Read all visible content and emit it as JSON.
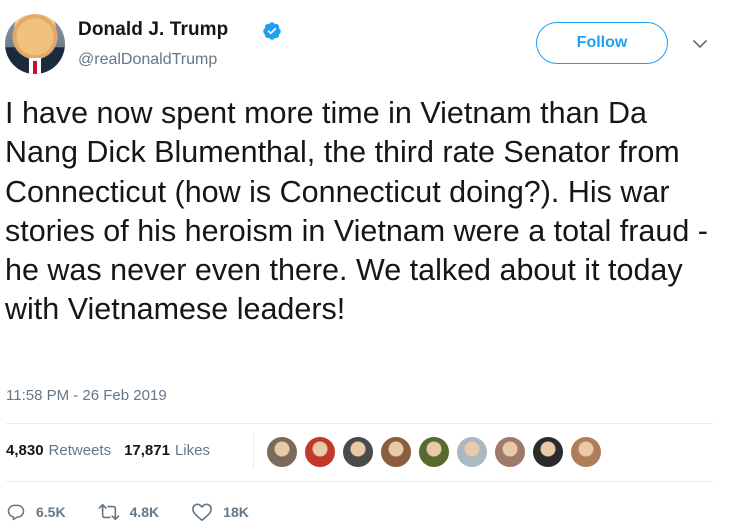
{
  "user": {
    "display_name": "Donald J. Trump",
    "handle": "@realDonaldTrump",
    "verified": true
  },
  "header": {
    "follow_label": "Follow"
  },
  "tweet": {
    "text": "I have now spent more time in Vietnam than Da Nang Dick Blumenthal, the third rate Senator from Connecticut (how is Connecticut doing?). His war stories of his heroism in Vietnam were a total fraud - he was never even there. We talked about it today with Vietnamese leaders!",
    "timestamp": "11:58 PM - 26 Feb 2019"
  },
  "stats": {
    "retweets_count": "4,830",
    "retweets_label": "Retweets",
    "likes_count": "17,871",
    "likes_label": "Likes"
  },
  "liker_avatars": [
    "#7a6a5c",
    "#c0392b",
    "#4a4a4a",
    "#8b5e3c",
    "#556b2f",
    "#aab8c2",
    "#9c7b6a",
    "#2b2b2b",
    "#b07d5a"
  ],
  "actions": {
    "reply_count": "6.5K",
    "retweet_count": "4.8K",
    "like_count": "18K"
  },
  "colors": {
    "accent": "#1da1f2",
    "text": "#14171a",
    "secondary": "#657786",
    "divider": "#e6ecf0"
  }
}
